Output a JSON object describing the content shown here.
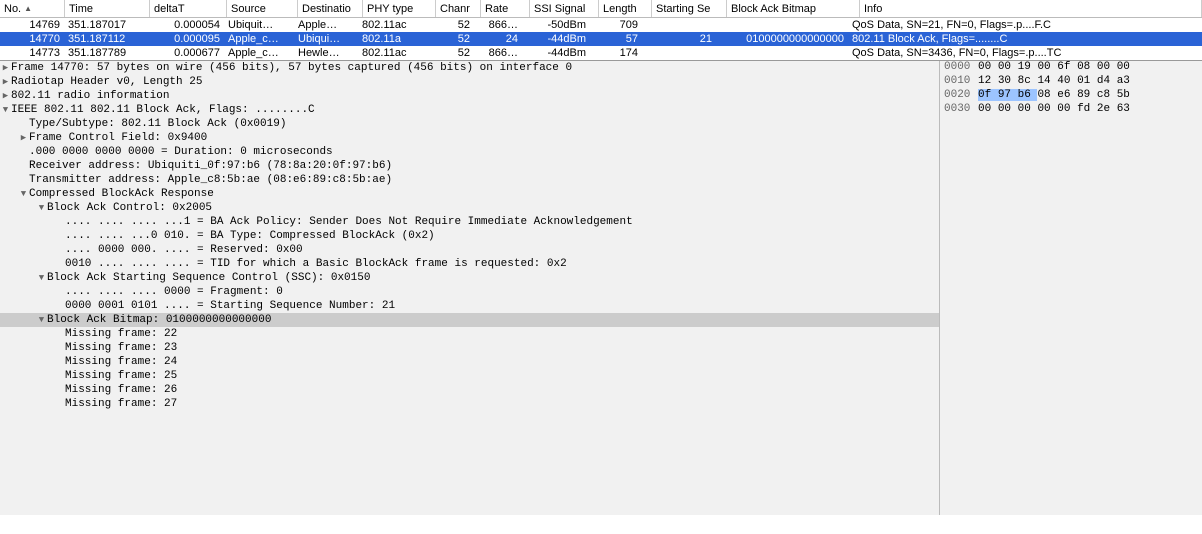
{
  "columns": {
    "no": "No.",
    "time": "Time",
    "dt": "deltaT",
    "src": "Source",
    "dst": "Destinatio",
    "phy": "PHY type",
    "chan": "Chanr",
    "rate": "Rate",
    "ssi": "SSI Signal",
    "len": "Length",
    "sseq": "Starting Se",
    "bab": "Block Ack Bitmap",
    "info": "Info"
  },
  "rows": [
    {
      "no": "14769",
      "time": "351.187017",
      "dt": "0.000054",
      "src": "Ubiquit…",
      "dst": "Apple…",
      "phy": "802.11ac",
      "chan": "52",
      "rate": "866…",
      "ssi": "-50dBm",
      "len": "709",
      "sseq": "",
      "bab": "",
      "info": "QoS Data, SN=21, FN=0, Flags=.p....F.C"
    },
    {
      "no": "14770",
      "time": "351.187112",
      "dt": "0.000095",
      "src": "Apple_c…",
      "dst": "Ubiqui…",
      "phy": "802.11a",
      "chan": "52",
      "rate": "24",
      "ssi": "-44dBm",
      "len": "57",
      "sseq": "21",
      "bab": "0100000000000000",
      "info": "802.11 Block Ack, Flags=........C",
      "sel": true
    },
    {
      "no": "14773",
      "time": "351.187789",
      "dt": "0.000677",
      "src": "Apple_c…",
      "dst": "Hewle…",
      "phy": "802.11ac",
      "chan": "52",
      "rate": "866…",
      "ssi": "-44dBm",
      "len": "174",
      "sseq": "",
      "bab": "",
      "info": "QoS Data, SN=3436, FN=0, Flags=.p....TC"
    }
  ],
  "tree": [
    {
      "l": 0,
      "t": "r",
      "x": "Frame 14770: 57 bytes on wire (456 bits), 57 bytes captured (456 bits) on interface 0"
    },
    {
      "l": 0,
      "t": "r",
      "x": "Radiotap Header v0, Length 25"
    },
    {
      "l": 0,
      "t": "r",
      "x": "802.11 radio information"
    },
    {
      "l": 0,
      "t": "d",
      "x": "IEEE 802.11 802.11 Block Ack, Flags: ........C"
    },
    {
      "l": 1,
      "t": " ",
      "x": "Type/Subtype: 802.11 Block Ack (0x0019)"
    },
    {
      "l": 1,
      "t": "r",
      "x": "Frame Control Field: 0x9400"
    },
    {
      "l": 1,
      "t": " ",
      "x": ".000 0000 0000 0000 = Duration: 0 microseconds"
    },
    {
      "l": 1,
      "t": " ",
      "x": "Receiver address: Ubiquiti_0f:97:b6 (78:8a:20:0f:97:b6)"
    },
    {
      "l": 1,
      "t": " ",
      "x": "Transmitter address: Apple_c8:5b:ae (08:e6:89:c8:5b:ae)"
    },
    {
      "l": 1,
      "t": "d",
      "x": "Compressed BlockAck Response"
    },
    {
      "l": 2,
      "t": "d",
      "x": "Block Ack Control: 0x2005"
    },
    {
      "l": 3,
      "t": " ",
      "x": ".... .... .... ...1 = BA Ack Policy: Sender Does Not Require Immediate Acknowledgement"
    },
    {
      "l": 3,
      "t": " ",
      "x": ".... .... ...0 010. = BA Type: Compressed BlockAck (0x2)"
    },
    {
      "l": 3,
      "t": " ",
      "x": ".... 0000 000. .... = Reserved: 0x00"
    },
    {
      "l": 3,
      "t": " ",
      "x": "0010 .... .... .... = TID for which a Basic BlockAck frame is requested: 0x2"
    },
    {
      "l": 2,
      "t": "d",
      "x": "Block Ack Starting Sequence Control (SSC): 0x0150"
    },
    {
      "l": 3,
      "t": " ",
      "x": ".... .... .... 0000 = Fragment: 0"
    },
    {
      "l": 3,
      "t": " ",
      "x": "0000 0001 0101 .... = Starting Sequence Number: 21"
    },
    {
      "l": 2,
      "t": "d",
      "x": "Block Ack Bitmap: 0100000000000000",
      "sel": true
    },
    {
      "l": 3,
      "t": " ",
      "x": "Missing frame: 22"
    },
    {
      "l": 3,
      "t": " ",
      "x": "Missing frame: 23"
    },
    {
      "l": 3,
      "t": " ",
      "x": "Missing frame: 24"
    },
    {
      "l": 3,
      "t": " ",
      "x": "Missing frame: 25"
    },
    {
      "l": 3,
      "t": " ",
      "x": "Missing frame: 26"
    },
    {
      "l": 3,
      "t": " ",
      "x": "Missing frame: 27"
    }
  ],
  "hex": [
    {
      "off": "0000",
      "b": [
        "00",
        "00",
        "19",
        "00",
        "6f",
        "08",
        "00",
        "00"
      ]
    },
    {
      "off": "0010",
      "b": [
        "12",
        "30",
        "8c",
        "14",
        "40",
        "01",
        "d4",
        "a3"
      ]
    },
    {
      "off": "0020",
      "b": [
        "0f",
        "97",
        "b6",
        "08",
        "e6",
        "89",
        "c8",
        "5b"
      ],
      "hl": [
        0,
        1,
        2
      ]
    },
    {
      "off": "0030",
      "b": [
        "00",
        "00",
        "00",
        "00",
        "00",
        "fd",
        "2e",
        "63"
      ]
    }
  ]
}
